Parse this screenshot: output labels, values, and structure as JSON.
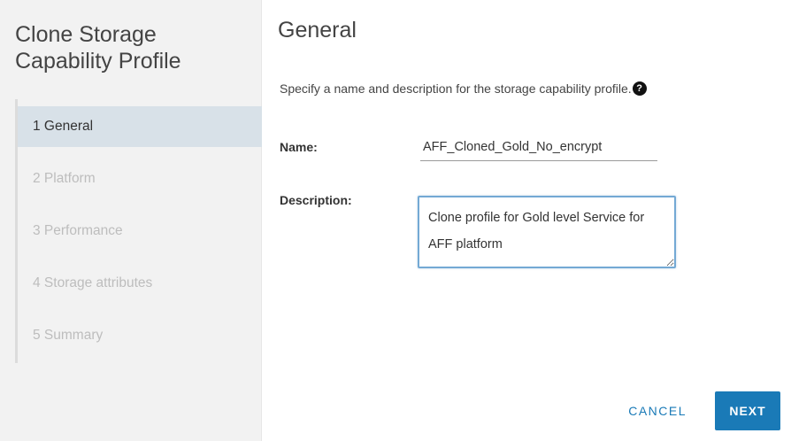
{
  "sidebar": {
    "title_line1": "Clone Storage",
    "title_line2": "Capability Profile",
    "steps": [
      {
        "label": "1 General",
        "state": "active"
      },
      {
        "label": "2 Platform",
        "state": "pending"
      },
      {
        "label": "3 Performance",
        "state": "pending"
      },
      {
        "label": "4 Storage attributes",
        "state": "pending"
      },
      {
        "label": "5 Summary",
        "state": "pending"
      }
    ]
  },
  "main": {
    "title": "General",
    "instructions": "Specify a name and description for the storage capability profile.",
    "help_icon_glyph": "?",
    "name_label": "Name:",
    "name_value": "AFF_Cloned_Gold_No_encrypt",
    "description_label": "Description:",
    "description_value": "Clone profile for Gold level Service for AFF platform"
  },
  "footer": {
    "cancel_label": "CANCEL",
    "next_label": "NEXT"
  },
  "colors": {
    "accent": "#1a7ab7",
    "active_step_bg": "#d8e1e8",
    "sidebar_bg": "#f2f2f2",
    "focus_border": "#74a9d4"
  }
}
